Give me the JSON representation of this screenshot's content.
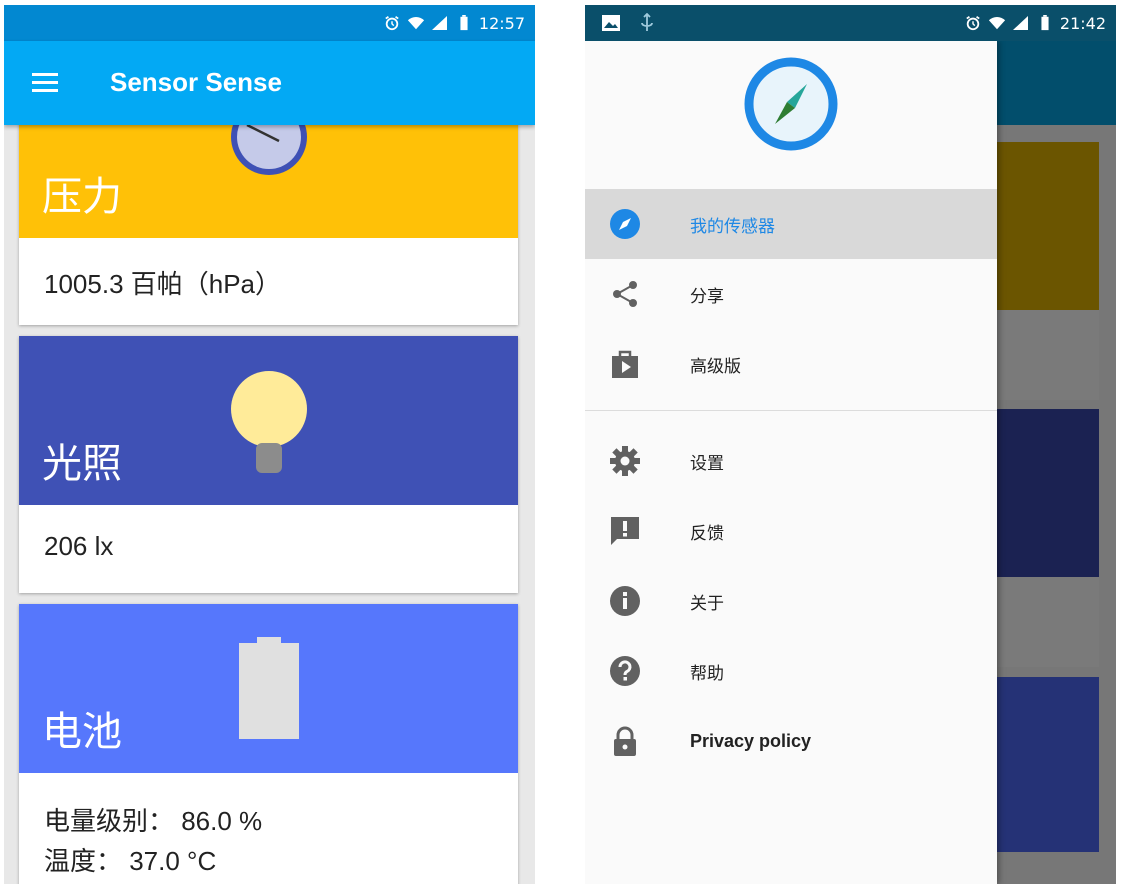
{
  "left_screen": {
    "status_bar": {
      "time": "12:57"
    },
    "app_bar": {
      "title": "Sensor Sense"
    },
    "cards": [
      {
        "title": "压力",
        "value": "1005.3 百帕（hPa）",
        "color": "#ffc107"
      },
      {
        "title": "光照",
        "value": "206 lx",
        "color": "#3f51b5"
      },
      {
        "title": "电池",
        "line1": "电量级别： 86.0 %",
        "line2": "温度： 37.0 °C",
        "color": "#5677fc"
      }
    ]
  },
  "right_screen": {
    "status_bar": {
      "time": "21:42"
    },
    "drawer": {
      "items_top": [
        {
          "label": "我的传感器",
          "icon": "compass-icon",
          "active": true
        },
        {
          "label": "分享",
          "icon": "share-icon"
        },
        {
          "label": "高级版",
          "icon": "shop-icon"
        }
      ],
      "items_bottom": [
        {
          "label": "设置",
          "icon": "gear-icon"
        },
        {
          "label": "反馈",
          "icon": "feedback-icon"
        },
        {
          "label": "关于",
          "icon": "info-icon"
        },
        {
          "label": "帮助",
          "icon": "help-icon"
        },
        {
          "label": "Privacy policy",
          "icon": "lock-icon"
        }
      ]
    }
  }
}
